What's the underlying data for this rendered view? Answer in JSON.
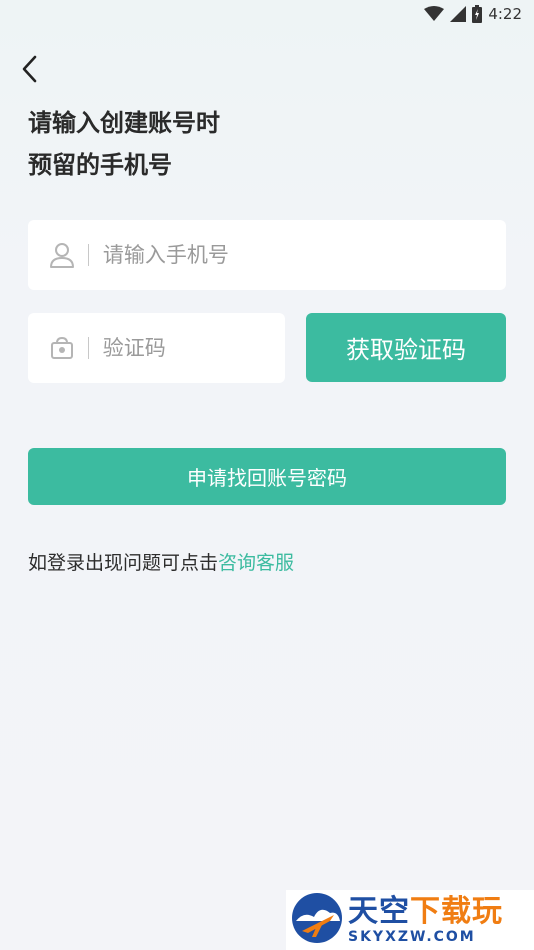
{
  "status_bar": {
    "time": "4:22"
  },
  "header": {
    "back_icon": "chevron-left-icon",
    "title_line1": "请输入创建账号时",
    "title_line2": "预留的手机号"
  },
  "form": {
    "phone": {
      "icon": "user-icon",
      "placeholder": "请输入手机号",
      "value": ""
    },
    "code": {
      "icon": "lock-icon",
      "placeholder": "验证码",
      "value": ""
    },
    "get_code_label": "获取验证码",
    "submit_label": "申请找回账号密码"
  },
  "help": {
    "text": "如登录出现问题可点击",
    "link": "咨询客服"
  },
  "watermark": {
    "cn_main": "天空",
    "cn_accent": "下载玩",
    "en": "SKYXZW.COM"
  },
  "colors": {
    "accent": "#3cbba0",
    "watermark_blue": "#1f4fa3",
    "watermark_orange": "#f07d12"
  }
}
